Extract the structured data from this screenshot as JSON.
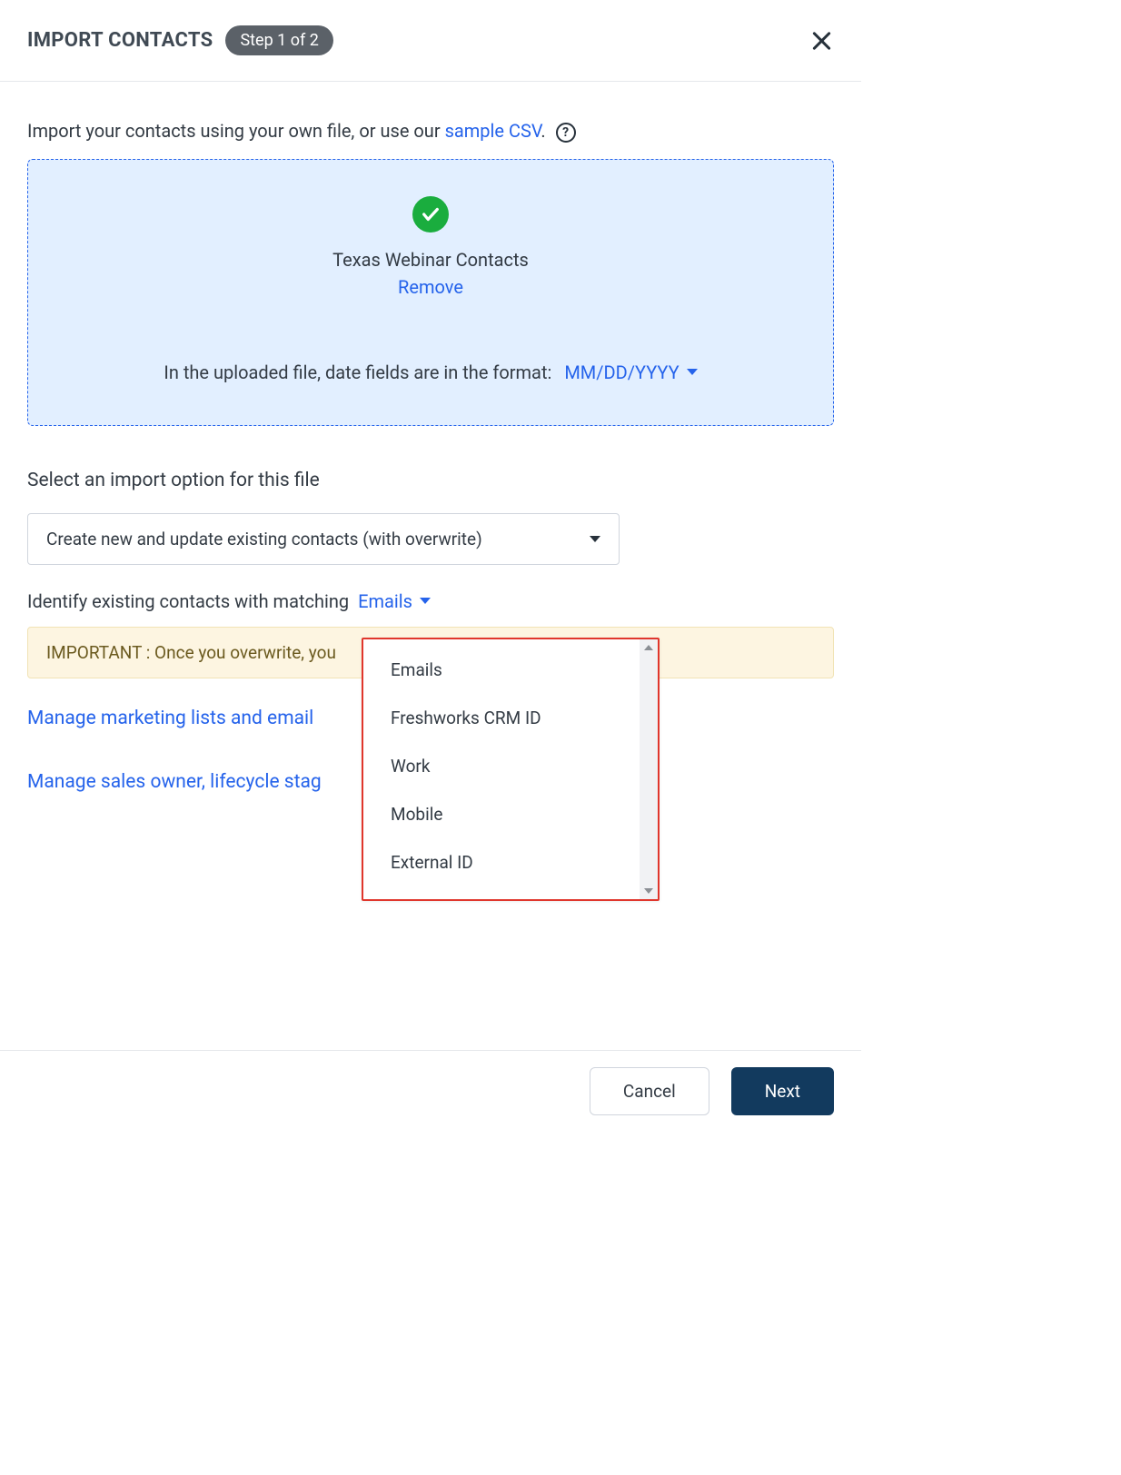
{
  "header": {
    "title": "IMPORT CONTACTS",
    "step": "Step 1 of 2"
  },
  "intro": {
    "text": "Import your contacts using your own file, or use our ",
    "sample_link": "sample CSV",
    "period": "."
  },
  "upload": {
    "filename": "Texas Webinar Contacts",
    "remove": "Remove",
    "date_label": "In the uploaded file, date fields are in the format:",
    "date_value": "MM/DD/YYYY"
  },
  "import_option": {
    "label": "Select an import option for this file",
    "selected": "Create new and update existing contacts (with overwrite)"
  },
  "match": {
    "label": "Identify existing contacts with matching",
    "selected": "Emails",
    "options": [
      "Emails",
      "Freshworks CRM ID",
      "Work",
      "Mobile",
      "External ID"
    ]
  },
  "warning": "IMPORTANT : Once you overwrite, you",
  "links": {
    "marketing": "Manage marketing lists and email",
    "sales": "Manage sales owner, lifecycle stag"
  },
  "footer": {
    "cancel": "Cancel",
    "next": "Next"
  }
}
